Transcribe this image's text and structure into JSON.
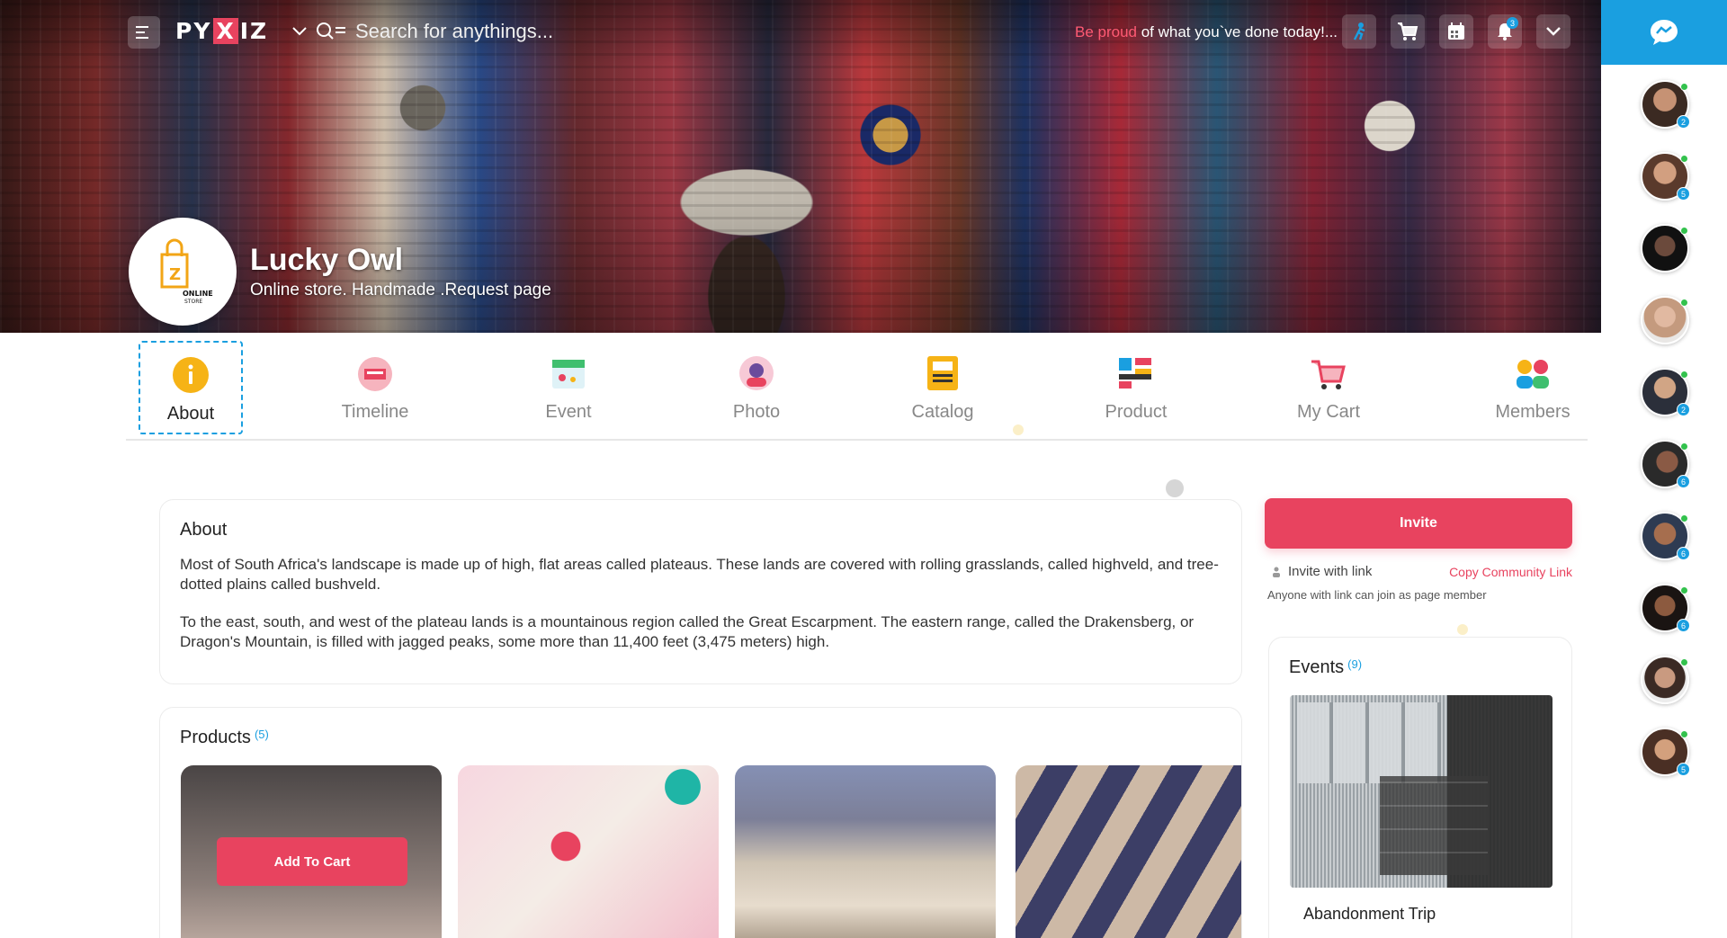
{
  "topbar": {
    "logo_left": "PY",
    "logo_x": "X",
    "logo_right": "IZ",
    "search_placeholder": "Search for anythings...",
    "motto_accent": "Be proud",
    "motto_rest": " of what you`ve done today!...",
    "notification_count": "3"
  },
  "profile": {
    "name": "Lucky Owl",
    "subtitle": "Online store. Handmade .Request page",
    "logo_text": "ONLINE STORE"
  },
  "tabs": [
    {
      "label": "About",
      "icon": "info-icon",
      "active": true
    },
    {
      "label": "Timeline",
      "icon": "timeline-icon"
    },
    {
      "label": "Event",
      "icon": "event-icon"
    },
    {
      "label": "Photo",
      "icon": "photo-icon"
    },
    {
      "label": "Catalog",
      "icon": "catalog-icon"
    },
    {
      "label": "Product",
      "icon": "product-icon"
    },
    {
      "label": "My Cart",
      "icon": "cart-icon"
    },
    {
      "label": "Members",
      "icon": "members-icon"
    }
  ],
  "about": {
    "title": "About",
    "paragraphs": [
      "Most of South Africa's landscape is made up of high, flat areas called plateaus. These lands are covered with rolling grasslands, called highveld, and tree-dotted plains called bushveld.",
      "To the east, south, and west of the plateau lands is a mountainous region called the Great Escarpment. The eastern range, called the Drakensberg, or Dragon's Mountain, is filled with jagged peaks, some more than 11,400 feet (3,475 meters) high."
    ]
  },
  "products": {
    "title": "Products",
    "count": "(5)",
    "add_to_cart": "Add To Cart"
  },
  "invite": {
    "button": "Invite",
    "link_label": "Invite with link",
    "copy_label": "Copy Community Link",
    "note": "Anyone with link can join as page member"
  },
  "events": {
    "title": "Events",
    "count": "(9)",
    "first_event": "Abandonment Trip"
  },
  "contacts": [
    {
      "count": "2"
    },
    {
      "count": "5"
    },
    {
      "count": ""
    },
    {
      "count": ""
    },
    {
      "count": "2"
    },
    {
      "count": "6"
    },
    {
      "count": "6"
    },
    {
      "count": "6"
    },
    {
      "count": ""
    },
    {
      "count": "5"
    }
  ],
  "colors": {
    "accent": "#e8435f",
    "brand_blue": "#1a9fe0"
  }
}
